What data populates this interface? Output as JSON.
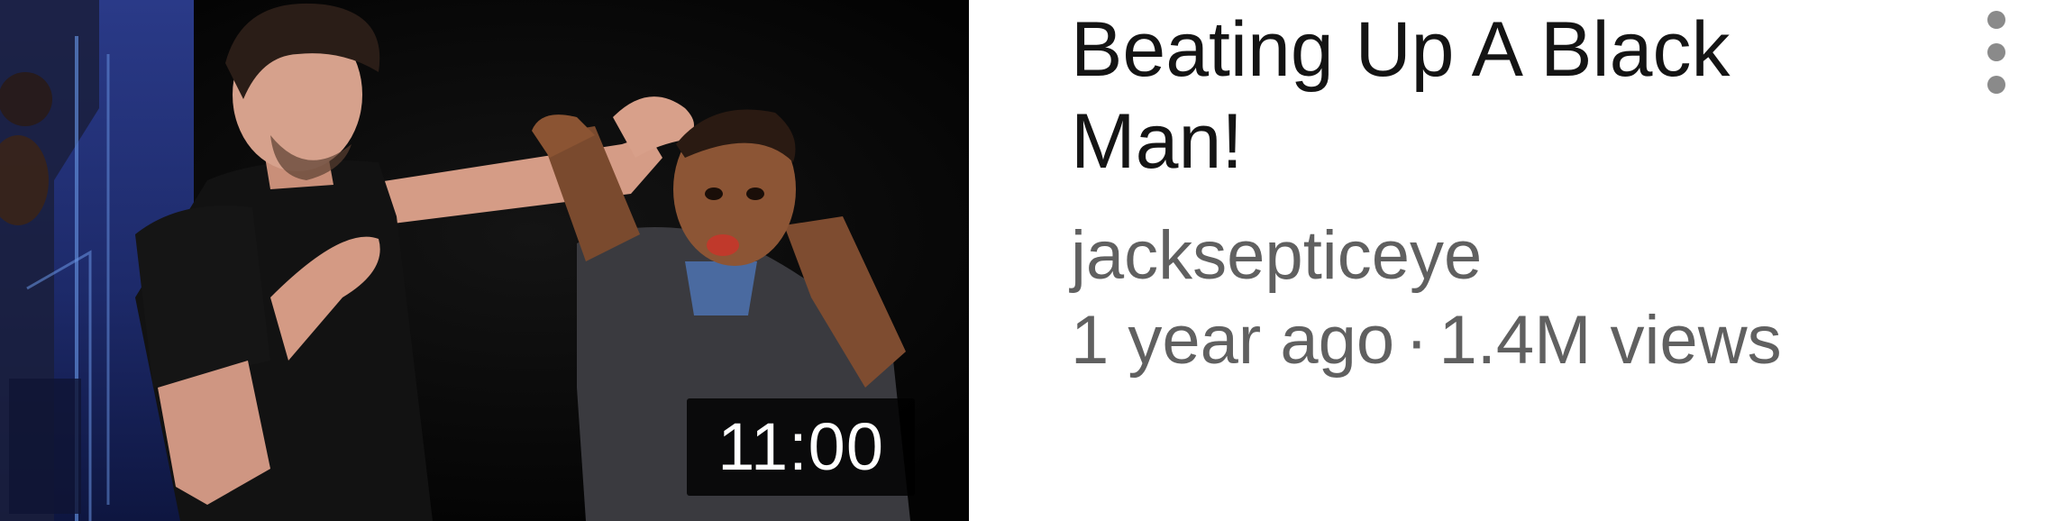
{
  "video": {
    "title": "Beating Up A Black Man!",
    "channel": "jacksepticeye",
    "age": "1 year ago",
    "separator": "·",
    "views": "1.4M views",
    "duration": "11:00"
  },
  "icons": {
    "menu": "more-vert-icon"
  },
  "colors": {
    "title": "#141414",
    "meta_text": "#606060",
    "badge_bg": "#000000",
    "badge_text": "#ffffff",
    "menu_dots": "#8a8a8a"
  }
}
